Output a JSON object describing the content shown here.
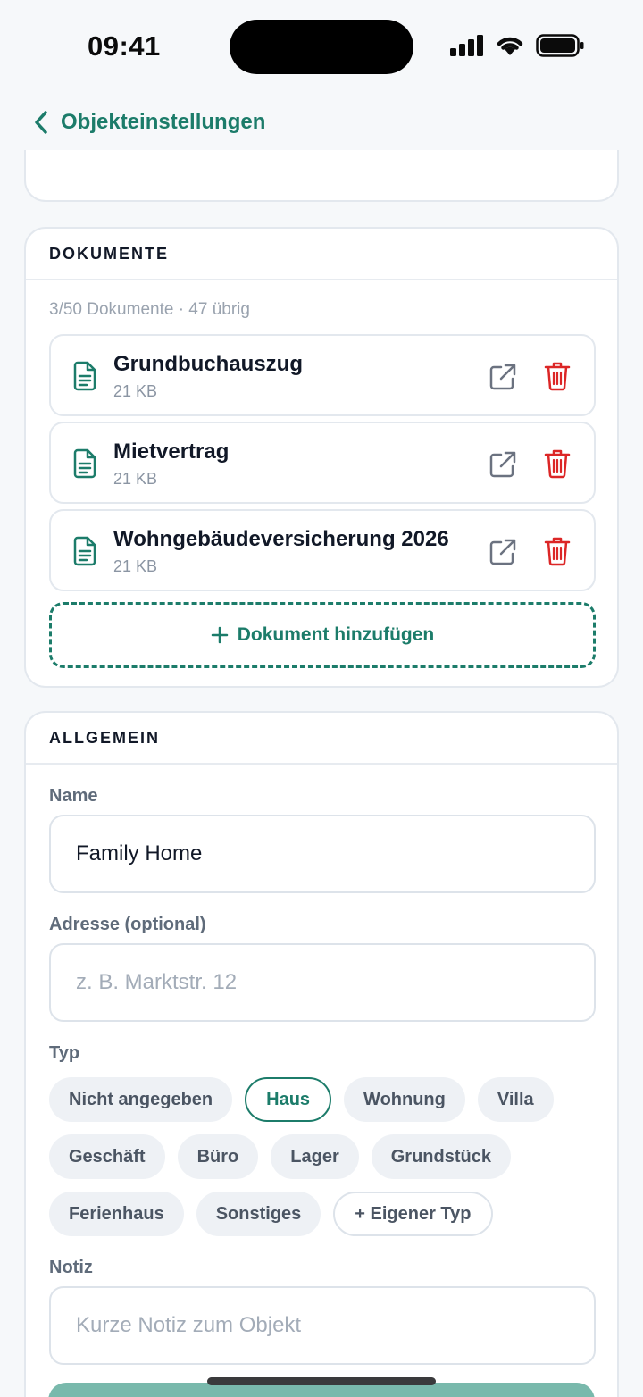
{
  "status_bar": {
    "time": "09:41"
  },
  "nav": {
    "back_label": "Objekteinstellungen"
  },
  "documents": {
    "header": "DOKUMENTE",
    "count_text": "3/50 Dokumente · 47 übrig",
    "items": [
      {
        "name": "Grundbuchauszug",
        "size": "21 KB"
      },
      {
        "name": "Mietvertrag",
        "size": "21 KB"
      },
      {
        "name": "Wohngebäudeversicherung 2026",
        "size": "21 KB"
      }
    ],
    "add_label": "Dokument hinzufügen"
  },
  "general": {
    "header": "ALLGEMEIN",
    "name_label": "Name",
    "name_value": "Family Home",
    "address_label": "Adresse (optional)",
    "address_placeholder": "z. B. Marktstr. 12",
    "type_label": "Typ",
    "types": [
      "Nicht angegeben",
      "Haus",
      "Wohnung",
      "Villa",
      "Geschäft",
      "Büro",
      "Lager",
      "Grundstück",
      "Ferienhaus",
      "Sonstiges"
    ],
    "selected_type": "Haus",
    "custom_type_label": "+ Eigener Typ",
    "note_label": "Notiz",
    "note_placeholder": "Kurze Notiz zum Objekt"
  },
  "colors": {
    "accent": "#1c7c6a",
    "danger": "#dc2626",
    "save_button": "#79b9ac"
  }
}
